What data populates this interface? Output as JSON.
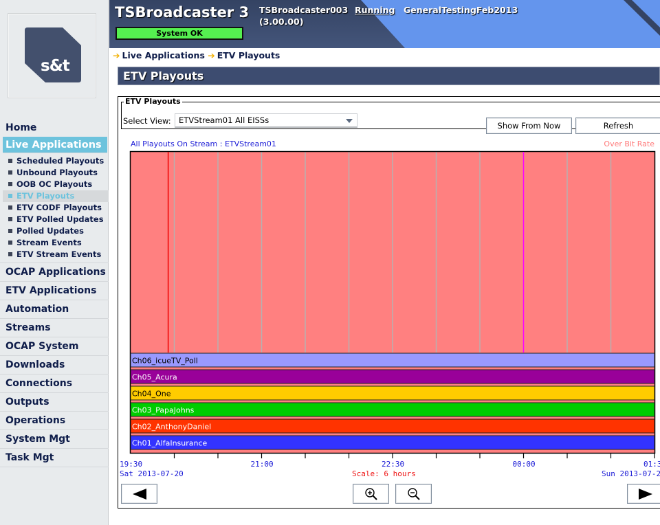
{
  "header": {
    "app_title": "TSBroadcaster 3",
    "system_status": "System OK",
    "host_name": "TSBroadcaster003",
    "host_version": "(3.00.00)",
    "run_status": "Running",
    "config_name": "GeneralTestingFeb2013",
    "colors": {
      "status_ok": "#55f050",
      "header_bg": "#3a4a6c",
      "accent": "#6495ed"
    }
  },
  "logo": {
    "text": "s&t",
    "icon": "st-logo-icon"
  },
  "sidebar": {
    "items": [
      {
        "label": "Home"
      },
      {
        "label": "Live Applications",
        "active": true,
        "children": [
          {
            "label": "Scheduled Playouts"
          },
          {
            "label": "Unbound Playouts"
          },
          {
            "label": "OOB OC Playouts"
          },
          {
            "label": "ETV Playouts",
            "active": true
          },
          {
            "label": "ETV CODF Playouts"
          },
          {
            "label": "ETV Polled Updates"
          },
          {
            "label": "Polled Updates"
          },
          {
            "label": "Stream Events"
          },
          {
            "label": "ETV Stream Events"
          }
        ]
      },
      {
        "label": "OCAP Applications"
      },
      {
        "label": "ETV Applications"
      },
      {
        "label": "Automation"
      },
      {
        "label": "Streams"
      },
      {
        "label": "OCAP System"
      },
      {
        "label": "Downloads"
      },
      {
        "label": "Connections"
      },
      {
        "label": "Outputs"
      },
      {
        "label": "Operations"
      },
      {
        "label": "System Mgt"
      },
      {
        "label": "Task Mgt"
      }
    ]
  },
  "breadcrumb": [
    "Live Applications",
    "ETV Playouts"
  ],
  "page_title": "ETV Playouts",
  "panel": {
    "legend": "ETV Playouts",
    "select_label": "Select View:",
    "select_value": "ETVStream01 All EISSs",
    "buttons": {
      "show_from_now": "Show From Now",
      "refresh": "Refresh"
    },
    "stream_label": "All Playouts On Stream : ETVStream01",
    "over_bit_rate_label": "Over Bit Rate",
    "date_start": "Sat 2013-07-20",
    "date_end": "Sun 2013-07-2",
    "scale_label": "Scale: 6 hours",
    "nav": {
      "prev": "previous-arrow-icon",
      "next": "next-arrow-icon",
      "zoom_in": "zoom-in-icon",
      "zoom_out": "zoom-out-icon"
    }
  },
  "chart_data": {
    "type": "timeline",
    "title": "All Playouts On Stream : ETVStream01",
    "x_range_hours": [
      19.5,
      25.5
    ],
    "x_tick_labels": [
      {
        "hour": 19.5,
        "label": "19:30"
      },
      {
        "hour": 21.0,
        "label": "21:00"
      },
      {
        "hour": 22.5,
        "label": "22:30"
      },
      {
        "hour": 24.0,
        "label": "00:00"
      },
      {
        "hour": 25.5,
        "label": "01:3"
      }
    ],
    "minor_tick_interval_hours": 0.5,
    "over_bit_rate_region": {
      "start": 19.5,
      "end": 25.5,
      "color": "#ff8080",
      "label": "Over Bit Rate"
    },
    "markers": [
      {
        "name": "current-time",
        "hour": 19.93,
        "color": "#ee0000"
      },
      {
        "name": "midnight",
        "hour": 24.0,
        "color": "#ff00ff"
      }
    ],
    "lanes": [
      {
        "label": "Ch06_icueTV_Poll",
        "start": 19.5,
        "end": 25.5,
        "color": "#9999ff",
        "text_color": "#000000"
      },
      {
        "label": "Ch05_Acura",
        "start": 19.5,
        "end": 25.5,
        "color": "#990099",
        "text_color": "#ffffff"
      },
      {
        "label": "Ch04_One",
        "start": 19.5,
        "end": 25.5,
        "color": "#ffcc00",
        "text_color": "#000000"
      },
      {
        "label": "Ch03_PapaJohns",
        "start": 19.5,
        "end": 25.5,
        "color": "#00cc00",
        "text_color": "#ffffff"
      },
      {
        "label": "Ch02_AnthonyDaniel",
        "start": 19.5,
        "end": 25.5,
        "color": "#ff3300",
        "text_color": "#ffffff"
      },
      {
        "label": "Ch01_AlfaInsurance",
        "start": 19.5,
        "end": 25.5,
        "color": "#3333ff",
        "text_color": "#ffffff"
      }
    ]
  }
}
